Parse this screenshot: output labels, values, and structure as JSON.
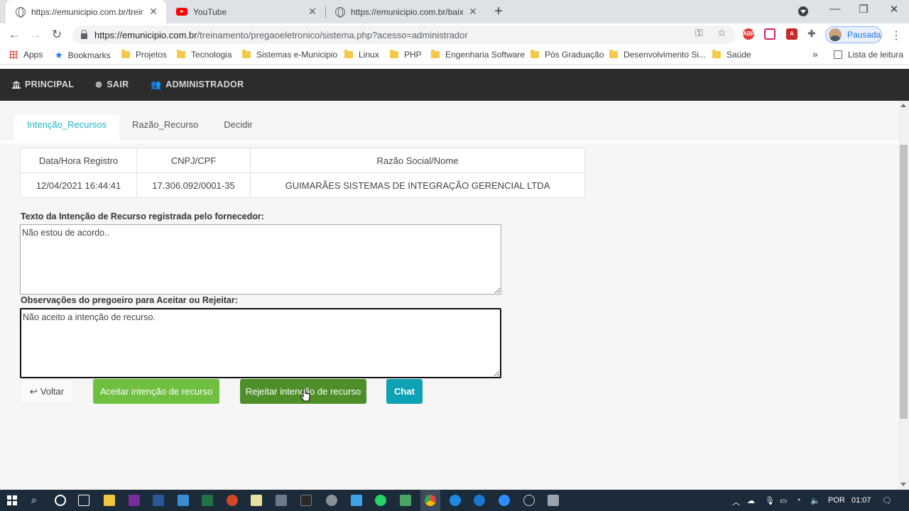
{
  "browser": {
    "tabs": [
      {
        "title": "https://emunicipio.com.br/treina",
        "icon": "globe-icon",
        "active": true
      },
      {
        "title": "YouTube",
        "icon": "youtube-icon",
        "active": false
      },
      {
        "title": "https://emunicipio.com.br/baixa",
        "icon": "globe-icon",
        "active": false
      }
    ],
    "url_host": "https://emunicipio.com.br",
    "url_path": "/treinamento/pregaoeletronico/sistema.php?acesso=administrador",
    "profile_label": "Pausada",
    "bookmarks": [
      "Apps",
      "Bookmarks",
      "Projetos",
      "Tecnologia",
      "Sistemas e-Municipio",
      "Linux",
      "PHP",
      "Engenharia Software",
      "Pós Graduação",
      "Desenvolvimento Si...",
      "Saúde"
    ],
    "more_bookmarks": "»",
    "reading_list": "Lista de leitura"
  },
  "navbar": {
    "principal": "PRINCIPAL",
    "sair": "SAIR",
    "administrador": "ADMINISTRADOR"
  },
  "page_tabs": [
    "Intenção_Recursos",
    "Razão_Recurso",
    "Decidir"
  ],
  "table": {
    "headers": [
      "Data/Hora Registro",
      "CNPJ/CPF",
      "Razão Social/Nome"
    ],
    "rows": [
      [
        "12/04/2021 16:44:41",
        "17.306.092/0001-35",
        "GUIMARÃES SISTEMAS DE INTEGRAÇÃO GERENCIAL LTDA"
      ]
    ]
  },
  "fields": {
    "intent_label": "Texto da Intenção de Recurso registrada pelo fornecedor:",
    "intent_value": "Não estou de acordo..",
    "obs_label": "Observações do pregoeiro para Aceitar ou Rejeitar:",
    "obs_value": "Não aceito a intenção de recurso."
  },
  "buttons": {
    "back": "Voltar",
    "accept": "Aceitar intenção de recurso",
    "reject": "Rejeitar intenção de recurso",
    "chat": "Chat"
  },
  "taskbar": {
    "language": "POR",
    "time": "01:07"
  },
  "colors": {
    "accent_tab": "#22b5c5",
    "accept": "#6fbf40",
    "reject": "#4e8f2a",
    "chat": "#0fa2b5",
    "navbar": "#2c2c2c"
  }
}
